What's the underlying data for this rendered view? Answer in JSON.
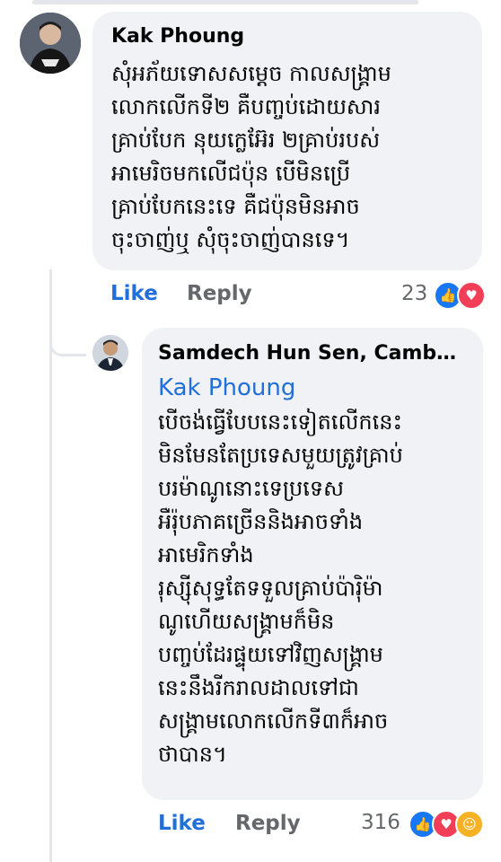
{
  "comment1": {
    "author": "Kak Phoung",
    "text": "សុំអភ័យទោសសម្តេច កាលសង្គ្រាម\nលោកលើកទី២ គឺបញ្ចប់ដោយសារ\nគ្រាប់បែក នុយក្លេអ៊ែរ ២គ្រាប់របស់\nអាមេរិចមកលើជប៉ុន បើមិនប្រើ\nគ្រាប់បែកនេះទេ គឺជប៉ុនមិនអាច\nចុះចាញ់ឬ សុំចុះចាញ់បានទេ។",
    "like_label": "Like",
    "reply_label": "Reply",
    "reaction_count": "23",
    "reactions": [
      "like-icon",
      "love-icon"
    ]
  },
  "reply1": {
    "author": "Samdech Hun Sen, Cambo...",
    "mention": "Kak Phoung",
    "text": "បើចង់ធ្វើបែបនេះទៀតលើកនេះ\nមិនមែនតែប្រទេសមួយត្រូវគ្រាប់\nបរម៉ាណូនោះទេប្រទេស\nអឺរ៉ុបភាគច្រើននិងអាចទាំង\nអាមេរិកទាំង\nរុស្ស៊ីសុទ្ធតែទទួលគ្រាប់ប៉ារ៉ិម៉ា\nណូហើយសង្គ្រាមក៏មិន\nបញ្ចប់ដែរផ្ទុយទៅវិញសង្គ្រាម\nនេះនឹងរីករាលដាលទៅជា\nសង្គ្រាមលោកលើកទី៣ក៏អាច\nថាបាន។",
    "like_label": "Like",
    "reply_label": "Reply",
    "reaction_count": "316",
    "reactions": [
      "like-icon",
      "love-icon",
      "care-icon"
    ]
  }
}
